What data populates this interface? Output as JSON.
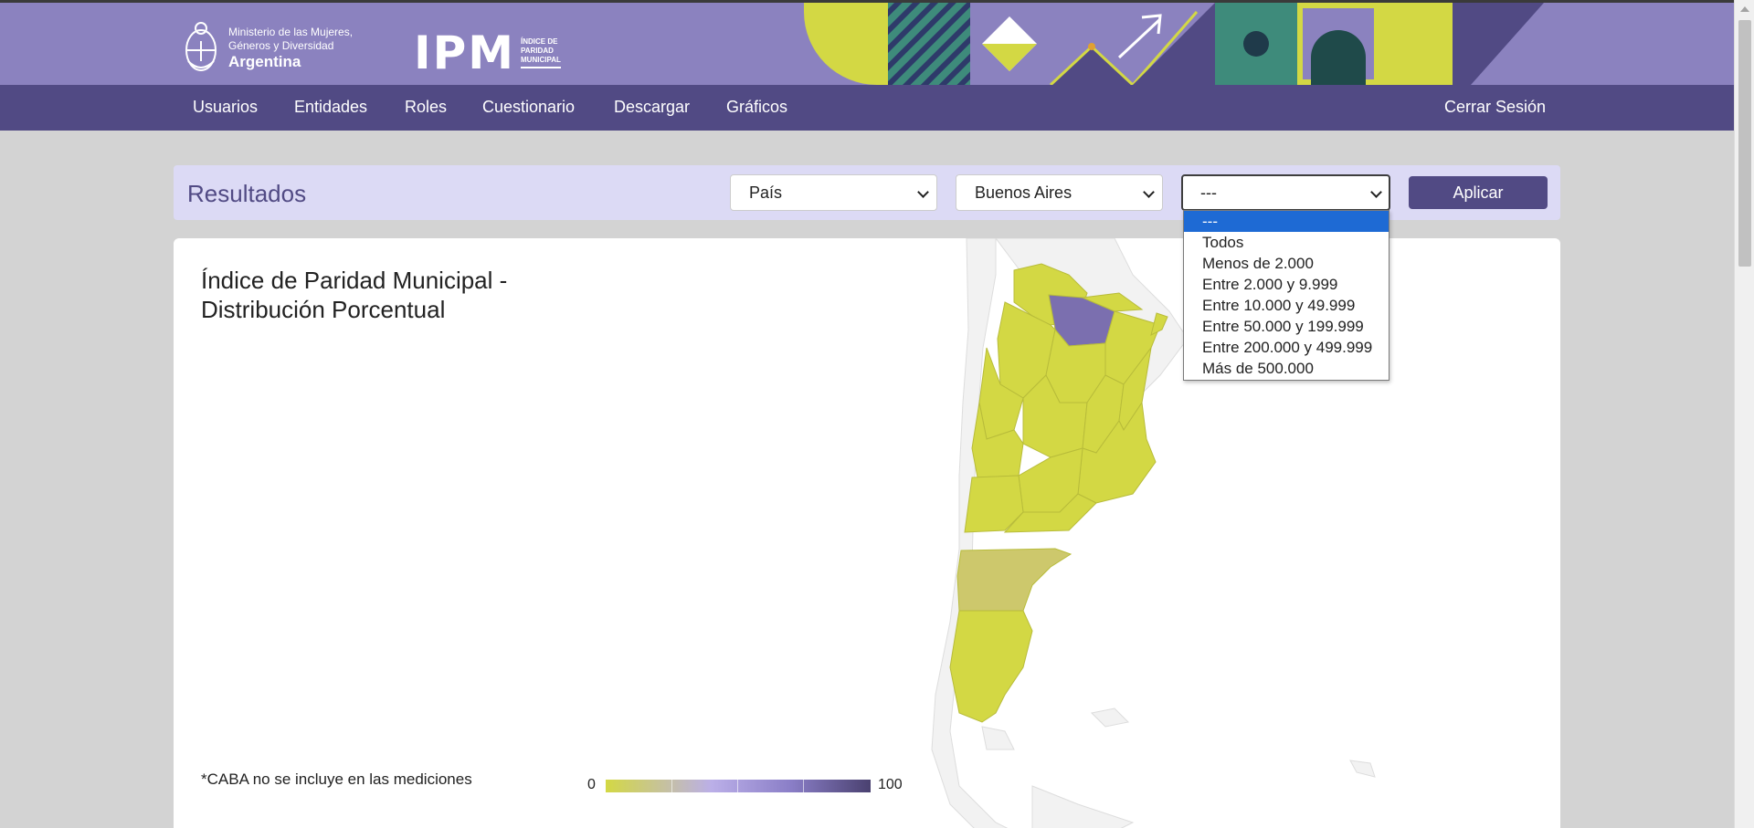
{
  "header": {
    "ministry_line1": "Ministerio de las Mujeres,",
    "ministry_line2": "Géneros y Diversidad",
    "country": "Argentina",
    "ipm_logo": "IPM",
    "ipm_sub1": "ÍNDICE DE",
    "ipm_sub2": "PARIDAD",
    "ipm_sub3": "MUNICIPAL"
  },
  "nav": {
    "items": [
      "Usuarios",
      "Entidades",
      "Roles",
      "Cuestionario",
      "Descargar",
      "Gráficos"
    ],
    "logout": "Cerrar Sesión"
  },
  "filters": {
    "title": "Resultados",
    "level_select": "País",
    "province_select": "Buenos Aires",
    "population_select": "---",
    "apply_label": "Aplicar",
    "population_options": [
      "---",
      "Todos",
      "Menos de 2.000",
      "Entre 2.000 y 9.999",
      "Entre 10.000 y 49.999",
      "Entre 50.000 y 199.999",
      "Entre 200.000 y 499.999",
      "Más de 500.000"
    ]
  },
  "chart": {
    "title": "Índice de Paridad Municipal - Distribución Porcentual",
    "note": "*CABA no se incluye en las mediciones",
    "legend_min": "0",
    "legend_max": "100",
    "colors": {
      "low": "#d3d844",
      "mid": "#bbafe8",
      "high": "#4a4170",
      "highlight": "#7b6faf",
      "muted": "#cdc86c",
      "neighbor": "#f2f2f2"
    }
  },
  "icons": {
    "shield": "argentina-shield-icon",
    "chevron": "chevron-down-icon"
  }
}
